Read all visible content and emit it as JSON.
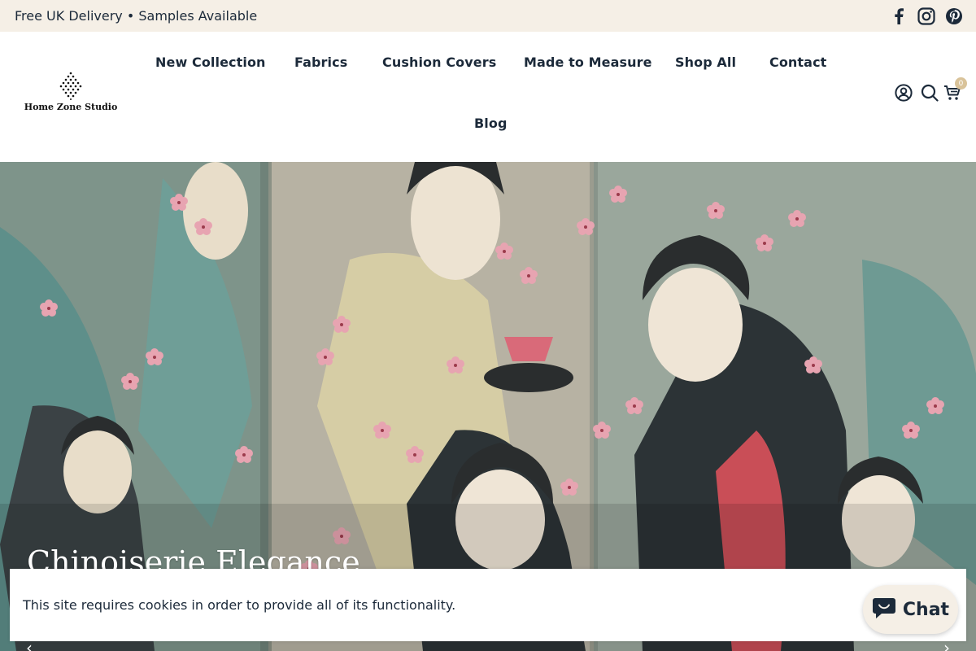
{
  "announcement": {
    "text": "Free UK Delivery • Samples Available"
  },
  "socials": [
    {
      "icon": "facebook-icon"
    },
    {
      "icon": "instagram-icon"
    },
    {
      "icon": "pinterest-icon"
    }
  ],
  "brand": {
    "name": "Home Zone Studio"
  },
  "nav": {
    "items": [
      {
        "label": "New Collection"
      },
      {
        "label": "Fabrics"
      },
      {
        "label": "Cushion Covers"
      },
      {
        "label": "Made to Measure"
      },
      {
        "label": "Shop All"
      },
      {
        "label": "Contact"
      },
      {
        "label": "Blog"
      }
    ]
  },
  "header_icons": {
    "account": "user-icon",
    "search": "search-icon",
    "cart": "cart-icon",
    "cart_count": "0"
  },
  "hero": {
    "title": "Chinoiserie Elegance",
    "prev": "‹",
    "next": "›"
  },
  "cookie": {
    "text": "This site requires cookies in order to provide all of its functionality."
  },
  "chat": {
    "label": "Chat"
  },
  "colors": {
    "announcement_bg": "#f5efe6",
    "text": "#1c2a3a",
    "badge": "#d9c39a"
  }
}
